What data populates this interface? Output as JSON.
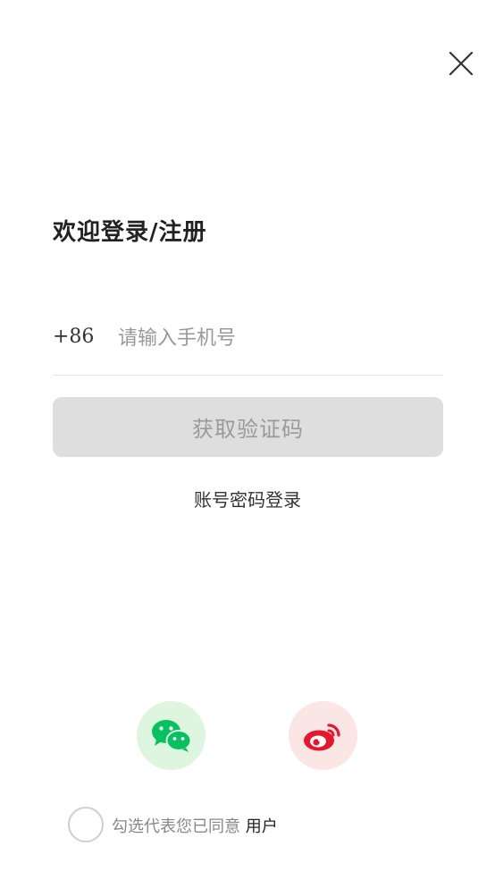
{
  "header": {
    "close_icon": "close-icon",
    "title": "欢迎登录/注册"
  },
  "phone": {
    "country_code": "+86",
    "value": "",
    "placeholder": "请输入手机号"
  },
  "actions": {
    "get_code_label": "获取验证码",
    "password_login_label": "账号密码登录"
  },
  "social": {
    "wechat_icon": "wechat-icon",
    "weibo_icon": "weibo-icon",
    "wechat_bg": "#def5e0",
    "wechat_color": "#07c160",
    "weibo_bg": "#fbe6e6",
    "weibo_color": "#e6162d"
  },
  "agreement": {
    "checked": false,
    "prefix": "勾选代表您已同意 ",
    "link_label": "用户"
  },
  "colors": {
    "button_bg": "#dedede",
    "button_text": "#9a9a9a",
    "divider": "#e6e6e6"
  }
}
